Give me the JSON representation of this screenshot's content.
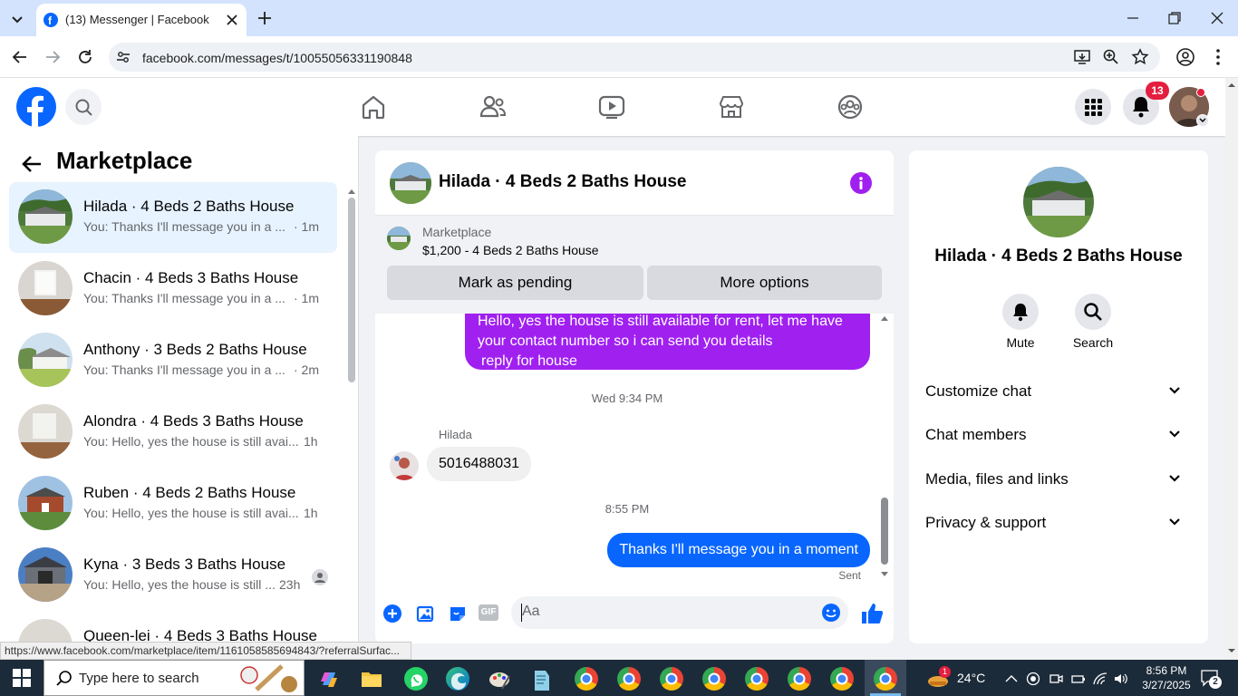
{
  "browser": {
    "tab_title": "(13) Messenger | Facebook",
    "url": "facebook.com/messages/t/10055056331190848"
  },
  "fb_header": {
    "notification_count": "13"
  },
  "left_panel": {
    "title": "Marketplace",
    "conversations": [
      {
        "name": "Hilada · 4 Beds 2 Baths House",
        "preview": "You: Thanks I'll message you in a ...",
        "time": "· 1m",
        "selected": true
      },
      {
        "name": "Chacin · 4 Beds 3 Baths House",
        "preview": "You: Thanks I'll message you in a ...",
        "time": "· 1m"
      },
      {
        "name": "Anthony · 3 Beds 2 Baths House",
        "preview": "You: Thanks I'll message you in a ...",
        "time": "· 2m"
      },
      {
        "name": "Alondra · 4 Beds 3 Baths House",
        "preview": "You: Hello, yes the house is still avai...",
        "time": "1h"
      },
      {
        "name": "Ruben · 4 Beds 2 Baths House",
        "preview": "You: Hello, yes the house is still avai...",
        "time": "1h"
      },
      {
        "name": "Kyna · 3 Beds 3 Baths House",
        "preview": "You: Hello, yes the house is still ...",
        "time": "23h"
      },
      {
        "name": "Queen-lei · 4 Beds 3 Baths House",
        "preview": "",
        "time": ""
      }
    ]
  },
  "chat": {
    "title": "Hilada · 4 Beds 2 Baths House",
    "marketplace_label": "Marketplace",
    "listing": "$1,200 - 4 Beds 2 Baths House",
    "mark_pending": "Mark as pending",
    "more_options": "More options",
    "sent_message_top": "Hello, yes the house is still available for rent, let me have your contact number so i can send you  details",
    "sent_message_top_2": "reply for house",
    "timestamp_1": "Wed 9:34 PM",
    "sender_name": "Hilada",
    "received_message": "5016488031",
    "timestamp_2": "8:55 PM",
    "sent_message": "Thanks I'll message you in a moment",
    "sent_status": "Sent",
    "composer_placeholder": "Aa",
    "gif_label": "GIF"
  },
  "right_panel": {
    "title": "Hilada · 4 Beds 2 Baths House",
    "mute_label": "Mute",
    "search_label": "Search",
    "sections": [
      "Customize chat",
      "Chat members",
      "Media, files and links",
      "Privacy & support"
    ]
  },
  "status_link": "https://www.facebook.com/marketplace/item/1161058585694843/?referralSurfac...",
  "taskbar": {
    "search_placeholder": "Type here to search",
    "weather": "24°C",
    "time": "8:56 PM",
    "date": "3/27/2025",
    "notification_badge": "2",
    "weather_badge": "1"
  },
  "colors": {
    "fb_blue": "#0866ff",
    "messenger_purple": "#a020f0",
    "notification_red": "#e41e3f"
  }
}
